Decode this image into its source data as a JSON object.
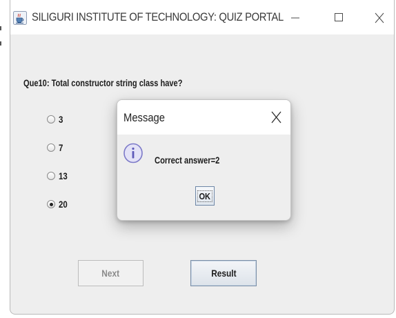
{
  "window": {
    "title": "SILIGURI INSTITUTE OF TECHNOLOGY: QUIZ PORTAL",
    "icon": "java-coffee-cup-icon"
  },
  "quiz": {
    "question": "Que10: Total constructor string class have?",
    "options": [
      {
        "label": "3",
        "selected": false
      },
      {
        "label": "7",
        "selected": false
      },
      {
        "label": "13",
        "selected": false
      },
      {
        "label": "20",
        "selected": true
      }
    ],
    "next_label": "Next",
    "next_enabled": false,
    "result_label": "Result"
  },
  "dialog": {
    "title": "Message",
    "close_glyph": "X",
    "icon": "information-icon",
    "message": "Correct answer=2",
    "ok_label": "OK"
  },
  "colors": {
    "window_bg": "#eeeeee",
    "titlebar_bg": "#ffffff",
    "info_icon_border": "#7c79c8",
    "info_icon_fill": "#e3e2f7"
  }
}
